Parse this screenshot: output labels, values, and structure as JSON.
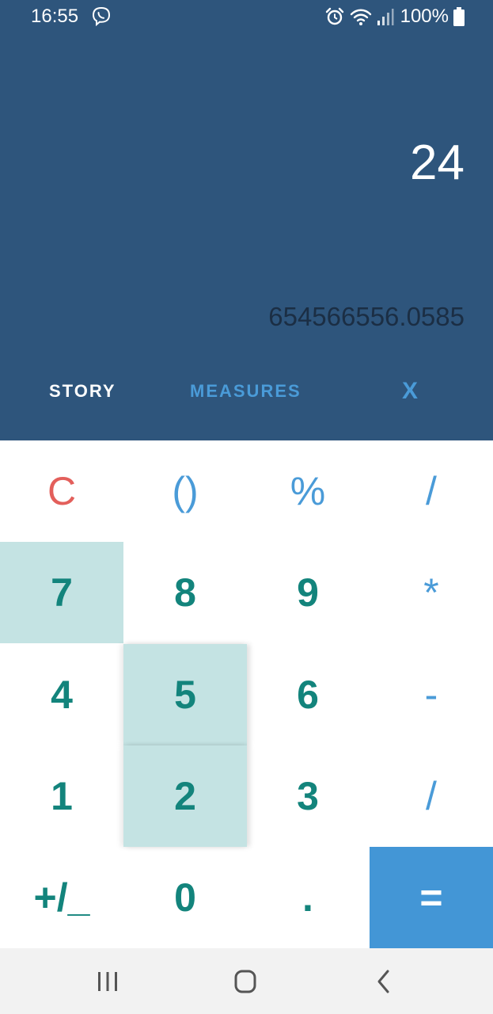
{
  "status_bar": {
    "time": "16:55",
    "battery": "100%",
    "icons": [
      "viber-icon",
      "alarm-icon",
      "wifi-icon",
      "signal-icon",
      "battery-icon"
    ]
  },
  "display": {
    "result": "24",
    "secondary": "654566556.0585"
  },
  "tabs": {
    "story": "STORY",
    "measures": "MEASURES",
    "close": "X"
  },
  "keypad": {
    "clear": "C",
    "parens": "()",
    "percent": "%",
    "divide": "/",
    "seven": "7",
    "eight": "8",
    "nine": "9",
    "multiply": "*",
    "four": "4",
    "five": "5",
    "six": "6",
    "minus": "-",
    "one": "1",
    "two": "2",
    "three": "3",
    "divide2": "/",
    "plus_minus": "+/_",
    "zero": "0",
    "decimal": ".",
    "equals": "="
  },
  "nav_bar": {
    "icons": [
      "recents-icon",
      "home-icon",
      "back-icon"
    ]
  },
  "colors": {
    "header_bg": "#2e557c",
    "accent_blue": "#4a9bd8",
    "teal_digits": "#13847c",
    "clear_red": "#e35f5b",
    "highlight": "#c4e3e3",
    "equals_bg": "#4396d6"
  }
}
